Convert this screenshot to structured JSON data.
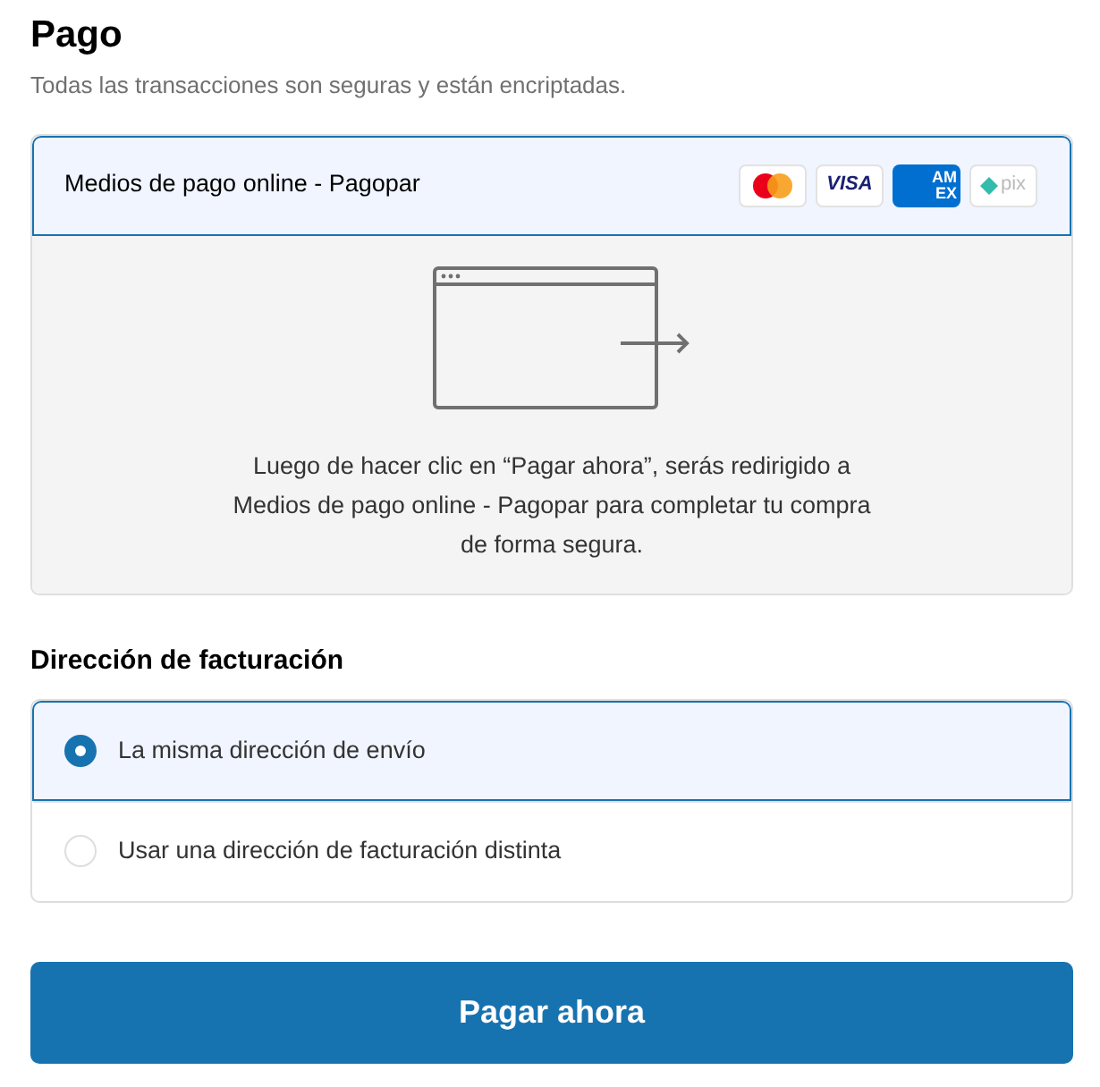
{
  "title": "Pago",
  "subtitle": "Todas las transacciones son seguras y están encriptadas.",
  "payment_method": {
    "label": "Medios de pago online - Pagopar",
    "selected": true,
    "logos": [
      {
        "kind": "mastercard"
      },
      {
        "kind": "visa",
        "label": "VISA"
      },
      {
        "kind": "amex",
        "label": "AM",
        "label_2": "EX"
      },
      {
        "kind": "pix",
        "label": "pix"
      }
    ],
    "message": "Luego de hacer clic en “Pagar ahora”, serás redirigido a Medios de pago online - Pagopar para completar tu compra de forma segura."
  },
  "billing": {
    "heading": "Dirección de facturación",
    "options": [
      {
        "label": "La misma dirección de envío",
        "selected": true
      },
      {
        "label": "Usar una dirección de facturación distinta",
        "selected": false
      }
    ]
  },
  "submit": "Pagar ahora"
}
